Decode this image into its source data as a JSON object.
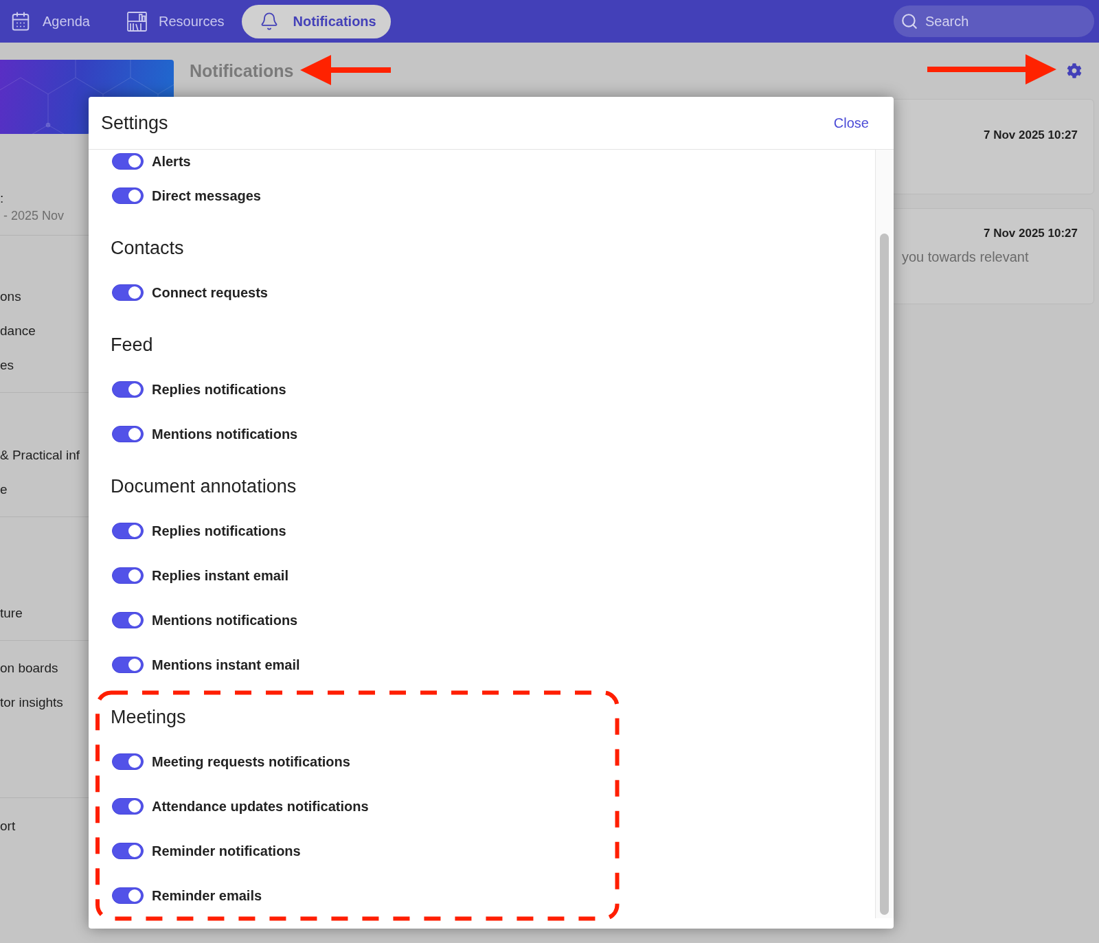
{
  "top_bar": {
    "nav": [
      {
        "label": "Agenda",
        "selected": false
      },
      {
        "label": "Resources",
        "selected": false
      },
      {
        "label": "Notifications",
        "selected": true
      }
    ],
    "search": {
      "placeholder": "Search"
    }
  },
  "sidebar": {
    "groups": [
      {
        "items": [
          {
            "text": ":",
            "kind": "label"
          },
          {
            "text": "- 2025 Nov",
            "kind": "caption"
          }
        ]
      },
      {
        "items": [
          {
            "text": "ons",
            "kind": "label"
          },
          {
            "text": "dance",
            "kind": "label"
          },
          {
            "text": "es",
            "kind": "label"
          }
        ]
      },
      {
        "items": [
          {
            "text": "& Practical inf",
            "kind": "label"
          },
          {
            "text": "e",
            "kind": "label"
          }
        ]
      },
      {
        "items": [
          {
            "text": "ture",
            "kind": "label"
          }
        ]
      },
      {
        "items": [
          {
            "text": "on boards",
            "kind": "label"
          },
          {
            "text": "tor insights",
            "kind": "label"
          }
        ]
      },
      {
        "items": [
          {
            "text": "ort",
            "kind": "label"
          }
        ]
      }
    ]
  },
  "page": {
    "title": "Notifications"
  },
  "notifications": [
    {
      "time": "7 Nov 2025 10:27"
    },
    {
      "time": "7 Nov 2025 10:27",
      "text": "you towards relevant"
    }
  ],
  "settings_dialog": {
    "title": "Settings",
    "close": "Close",
    "sections": [
      {
        "items": [
          {
            "label": "Alerts",
            "on": true
          },
          {
            "label": "Direct messages",
            "on": true
          }
        ]
      },
      {
        "heading": "Contacts",
        "items": [
          {
            "label": "Connect requests",
            "on": true
          }
        ]
      },
      {
        "heading": "Feed",
        "items": [
          {
            "label": "Replies notifications",
            "on": true
          },
          {
            "label": "Mentions notifications",
            "on": true
          }
        ]
      },
      {
        "heading": "Document annotations",
        "items": [
          {
            "label": "Replies notifications",
            "on": true
          },
          {
            "label": "Replies instant email",
            "on": true
          },
          {
            "label": "Mentions notifications",
            "on": true
          },
          {
            "label": "Mentions instant email",
            "on": true
          }
        ]
      },
      {
        "heading": "Meetings",
        "items": [
          {
            "label": "Meeting requests notifications",
            "on": true
          },
          {
            "label": "Attendance updates notifications",
            "on": true
          },
          {
            "label": "Reminder notifications",
            "on": true
          },
          {
            "label": "Reminder emails",
            "on": true
          }
        ]
      }
    ]
  }
}
